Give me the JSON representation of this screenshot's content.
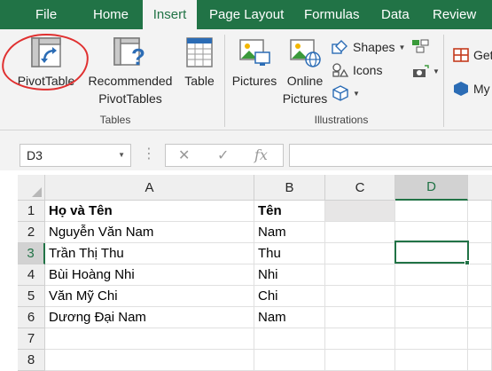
{
  "tabs": [
    {
      "label": "File",
      "active": false
    },
    {
      "label": "Home",
      "active": false
    },
    {
      "label": "Insert",
      "active": true
    },
    {
      "label": "Page Layout",
      "active": false
    },
    {
      "label": "Formulas",
      "active": false
    },
    {
      "label": "Data",
      "active": false
    },
    {
      "label": "Review",
      "active": false
    }
  ],
  "ribbon": {
    "pivottable": "PivotTable",
    "recommended_line1": "Recommended",
    "recommended_line2": "PivotTables",
    "table": "Table",
    "tables_group": "Tables",
    "pictures": "Pictures",
    "online_line1": "Online",
    "online_line2": "Pictures",
    "shapes": "Shapes",
    "icons": "Icons",
    "illustrations_group": "Illustrations",
    "get_addins": "Get",
    "my_addins": "My"
  },
  "formula_bar": {
    "name_box": "D3",
    "fx": "fx",
    "cancel_symbol": "✕",
    "enter_symbol": "✓",
    "formula_value": ""
  },
  "columns": [
    "A",
    "B",
    "C",
    "D"
  ],
  "selected_column": "D",
  "rows": [
    {
      "num": "1",
      "a": "Họ và Tên",
      "b": "Tên",
      "header": true
    },
    {
      "num": "2",
      "a": "Nguyễn Văn Nam",
      "b": "Nam"
    },
    {
      "num": "3",
      "a": "Trần Thị Thu",
      "b": "Thu"
    },
    {
      "num": "4",
      "a": "Bùi Hoàng Nhi",
      "b": "Nhi"
    },
    {
      "num": "5",
      "a": "Văn Mỹ Chi",
      "b": "Chi"
    },
    {
      "num": "6",
      "a": "Dương Đại Nam",
      "b": "Nam"
    },
    {
      "num": "7",
      "a": "",
      "b": ""
    },
    {
      "num": "8",
      "a": "",
      "b": ""
    }
  ],
  "selected_row": "3",
  "colors": {
    "brand_green": "#217346",
    "annotation_red": "#e03030"
  }
}
